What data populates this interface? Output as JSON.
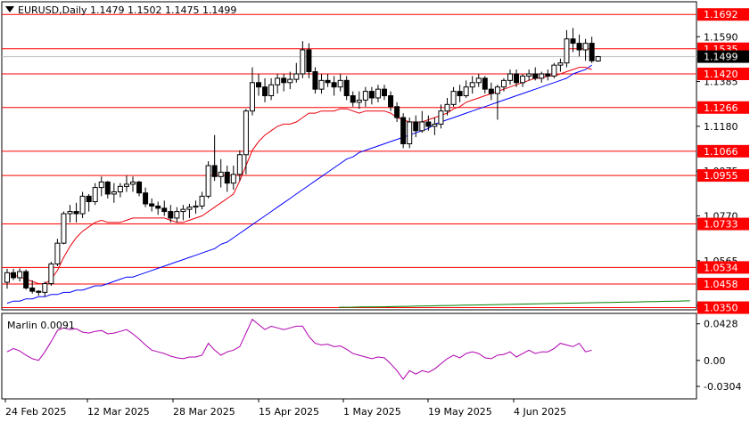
{
  "header": {
    "symbol": "EURUSD,Daily",
    "ohlc": "1.1479 1.1502 1.1475 1.1499"
  },
  "indicator": {
    "name": "Marlin",
    "value": "0.0091",
    "axis_ticks": [
      "0.0428",
      "0.00",
      "-0.0304"
    ]
  },
  "colors": {
    "level_line": "#ff0000",
    "candle_bull_body": "#ffffff",
    "candle_bear_body": "#000000",
    "ma_fast": "#e8000b",
    "ma_slow": "#0000ff",
    "ma_long": "#008000",
    "oscillator": "#b000b0",
    "price_label_bg": "#ff0000",
    "current_price_label_bg": "#000000"
  },
  "chart_data": {
    "type": "candlestick",
    "title": "EURUSD,Daily",
    "y_axis_ticks": [
      "1.1590",
      "1.1385",
      "1.1180",
      "1.0975",
      "1.0770",
      "1.0565",
      "1.0360"
    ],
    "x_axis_ticks": [
      "24 Feb 2025",
      "12 Mar 2025",
      "28 Mar 2025",
      "15 Apr 2025",
      "1 May 2025",
      "19 May 2025",
      "4 Jun 2025"
    ],
    "horizontal_levels": [
      "1.1692",
      "1.1535",
      "1.1420",
      "1.1266",
      "1.1066",
      "1.0955",
      "1.0733",
      "1.0534",
      "1.0458",
      "1.0350"
    ],
    "current_price": "1.1499",
    "ylim": [
      1.034,
      1.175
    ],
    "candles_ohlc": [
      [
        1.0466,
        1.0528,
        1.0437,
        1.051
      ],
      [
        1.051,
        1.0528,
        1.0476,
        1.0487
      ],
      [
        1.0487,
        1.053,
        1.047,
        1.0515
      ],
      [
        1.0515,
        1.0525,
        1.0432,
        1.044
      ],
      [
        1.044,
        1.0475,
        1.0415,
        1.0425
      ],
      [
        1.0425,
        1.043,
        1.0405,
        1.042
      ],
      [
        1.042,
        1.047,
        1.04,
        1.046
      ],
      [
        1.046,
        1.056,
        1.045,
        1.055
      ],
      [
        1.055,
        1.0665,
        1.054,
        1.0645
      ],
      [
        1.0645,
        1.079,
        1.064,
        1.078
      ],
      [
        1.078,
        1.082,
        1.074,
        1.079
      ],
      [
        1.079,
        1.083,
        1.074,
        1.078
      ],
      [
        1.078,
        1.088,
        1.076,
        1.086
      ],
      [
        1.086,
        1.087,
        1.079,
        1.0835
      ],
      [
        1.0835,
        1.092,
        1.082,
        1.09
      ],
      [
        1.09,
        1.095,
        1.086,
        1.0925
      ],
      [
        1.0925,
        1.093,
        1.085,
        1.087
      ],
      [
        1.087,
        1.092,
        1.083,
        1.088
      ],
      [
        1.088,
        1.092,
        1.0855,
        1.0905
      ],
      [
        1.0905,
        1.0955,
        1.088,
        1.0915
      ],
      [
        1.0915,
        1.095,
        1.088,
        1.0925
      ],
      [
        1.0925,
        1.093,
        1.086,
        1.0875
      ],
      [
        1.0875,
        1.09,
        1.081,
        1.0825
      ],
      [
        1.0825,
        1.085,
        1.079,
        1.0815
      ],
      [
        1.0815,
        1.0835,
        1.0775,
        1.0805
      ],
      [
        1.0805,
        1.084,
        1.077,
        1.079
      ],
      [
        1.079,
        1.082,
        1.074,
        1.076
      ],
      [
        1.076,
        1.081,
        1.074,
        1.079
      ],
      [
        1.079,
        1.082,
        1.075,
        1.08
      ],
      [
        1.08,
        1.0825,
        1.076,
        1.081
      ],
      [
        1.081,
        1.084,
        1.078,
        1.0815
      ],
      [
        1.0815,
        1.088,
        1.08,
        1.086
      ],
      [
        1.086,
        1.102,
        1.085,
        1.1
      ],
      [
        1.1,
        1.114,
        1.093,
        1.095
      ],
      [
        1.095,
        1.103,
        1.09,
        1.097
      ],
      [
        1.097,
        1.1,
        1.088,
        1.092
      ],
      [
        1.092,
        1.1,
        1.089,
        1.096
      ],
      [
        1.096,
        1.107,
        1.093,
        1.105
      ],
      [
        1.105,
        1.126,
        1.096,
        1.125
      ],
      [
        1.125,
        1.145,
        1.123,
        1.138
      ],
      [
        1.138,
        1.142,
        1.132,
        1.136
      ],
      [
        1.136,
        1.14,
        1.129,
        1.132
      ],
      [
        1.132,
        1.14,
        1.13,
        1.137
      ],
      [
        1.137,
        1.142,
        1.133,
        1.14
      ],
      [
        1.14,
        1.142,
        1.134,
        1.138
      ],
      [
        1.138,
        1.143,
        1.135,
        1.1395
      ],
      [
        1.1395,
        1.147,
        1.138,
        1.142
      ],
      [
        1.142,
        1.157,
        1.14,
        1.153
      ],
      [
        1.153,
        1.156,
        1.14,
        1.143
      ],
      [
        1.143,
        1.145,
        1.133,
        1.135
      ],
      [
        1.135,
        1.142,
        1.133,
        1.139
      ],
      [
        1.139,
        1.142,
        1.136,
        1.138
      ],
      [
        1.138,
        1.141,
        1.132,
        1.136
      ],
      [
        1.136,
        1.142,
        1.134,
        1.139
      ],
      [
        1.139,
        1.141,
        1.13,
        1.132
      ],
      [
        1.132,
        1.134,
        1.127,
        1.129
      ],
      [
        1.129,
        1.134,
        1.126,
        1.13
      ],
      [
        1.13,
        1.136,
        1.127,
        1.134
      ],
      [
        1.134,
        1.136,
        1.128,
        1.131
      ],
      [
        1.131,
        1.137,
        1.129,
        1.135
      ],
      [
        1.135,
        1.137,
        1.13,
        1.132
      ],
      [
        1.132,
        1.134,
        1.125,
        1.127
      ],
      [
        1.127,
        1.129,
        1.12,
        1.122
      ],
      [
        1.122,
        1.124,
        1.108,
        1.11
      ],
      [
        1.11,
        1.122,
        1.108,
        1.12
      ],
      [
        1.12,
        1.123,
        1.113,
        1.116
      ],
      [
        1.116,
        1.125,
        1.115,
        1.12
      ],
      [
        1.12,
        1.123,
        1.116,
        1.118
      ],
      [
        1.118,
        1.122,
        1.114,
        1.119
      ],
      [
        1.119,
        1.128,
        1.117,
        1.125
      ],
      [
        1.125,
        1.131,
        1.123,
        1.128
      ],
      [
        1.128,
        1.136,
        1.127,
        1.134
      ],
      [
        1.134,
        1.137,
        1.129,
        1.132
      ],
      [
        1.132,
        1.139,
        1.131,
        1.136
      ],
      [
        1.136,
        1.141,
        1.133,
        1.138
      ],
      [
        1.138,
        1.142,
        1.136,
        1.14
      ],
      [
        1.14,
        1.141,
        1.133,
        1.135
      ],
      [
        1.135,
        1.138,
        1.13,
        1.133
      ],
      [
        1.133,
        1.137,
        1.121,
        1.136
      ],
      [
        1.136,
        1.14,
        1.134,
        1.139
      ],
      [
        1.139,
        1.144,
        1.137,
        1.142
      ],
      [
        1.142,
        1.144,
        1.136,
        1.138
      ],
      [
        1.138,
        1.142,
        1.136,
        1.141
      ],
      [
        1.141,
        1.144,
        1.139,
        1.142
      ],
      [
        1.142,
        1.145,
        1.139,
        1.14
      ],
      [
        1.14,
        1.143,
        1.138,
        1.142
      ],
      [
        1.142,
        1.144,
        1.139,
        1.141
      ],
      [
        1.141,
        1.147,
        1.14,
        1.146
      ],
      [
        1.146,
        1.149,
        1.143,
        1.147
      ],
      [
        1.147,
        1.162,
        1.145,
        1.158
      ],
      [
        1.158,
        1.163,
        1.152,
        1.156
      ],
      [
        1.156,
        1.16,
        1.15,
        1.153
      ],
      [
        1.153,
        1.158,
        1.148,
        1.156
      ],
      [
        1.156,
        1.159,
        1.147,
        1.148
      ],
      [
        1.1479,
        1.1502,
        1.1475,
        1.1499
      ]
    ],
    "ma_fast": [
      1.051,
      1.05,
      1.049,
      1.048,
      1.047,
      1.046,
      1.046,
      1.048,
      1.052,
      1.058,
      1.063,
      1.067,
      1.07,
      1.072,
      1.074,
      1.075,
      1.074,
      1.074,
      1.074,
      1.075,
      1.076,
      1.076,
      1.076,
      1.076,
      1.076,
      1.076,
      1.075,
      1.074,
      1.074,
      1.075,
      1.076,
      1.077,
      1.079,
      1.081,
      1.083,
      1.085,
      1.087,
      1.093,
      1.1,
      1.107,
      1.111,
      1.114,
      1.116,
      1.118,
      1.119,
      1.119,
      1.12,
      1.122,
      1.124,
      1.124,
      1.125,
      1.125,
      1.125,
      1.126,
      1.126,
      1.125,
      1.124,
      1.125,
      1.125,
      1.125,
      1.125,
      1.124,
      1.122,
      1.121,
      1.12,
      1.12,
      1.12,
      1.121,
      1.122,
      1.123,
      1.124,
      1.126,
      1.127,
      1.129,
      1.13,
      1.131,
      1.132,
      1.133,
      1.134,
      1.135,
      1.136,
      1.137,
      1.138,
      1.139,
      1.14,
      1.14,
      1.141,
      1.141,
      1.142,
      1.143,
      1.144,
      1.145,
      1.145,
      1.144
    ],
    "ma_slow": [
      1.037,
      1.038,
      1.038,
      1.039,
      1.039,
      1.04,
      1.04,
      1.041,
      1.041,
      1.042,
      1.042,
      1.043,
      1.043,
      1.044,
      1.045,
      1.045,
      1.046,
      1.047,
      1.048,
      1.049,
      1.049,
      1.05,
      1.051,
      1.052,
      1.053,
      1.054,
      1.055,
      1.056,
      1.057,
      1.058,
      1.059,
      1.06,
      1.061,
      1.062,
      1.064,
      1.065,
      1.067,
      1.069,
      1.071,
      1.073,
      1.075,
      1.077,
      1.079,
      1.081,
      1.083,
      1.085,
      1.087,
      1.089,
      1.091,
      1.093,
      1.095,
      1.097,
      1.099,
      1.101,
      1.103,
      1.104,
      1.106,
      1.107,
      1.108,
      1.109,
      1.11,
      1.111,
      1.112,
      1.113,
      1.114,
      1.115,
      1.116,
      1.117,
      1.119,
      1.12,
      1.121,
      1.122,
      1.123,
      1.124,
      1.125,
      1.126,
      1.127,
      1.128,
      1.129,
      1.13,
      1.131,
      1.132,
      1.133,
      1.134,
      1.135,
      1.136,
      1.137,
      1.138,
      1.139,
      1.14,
      1.142,
      1.143,
      1.144,
      1.146
    ],
    "ma_long": [
      1.0352,
      1.0352,
      1.0353,
      1.0353,
      1.0354,
      1.0355,
      1.0356,
      1.0357,
      1.0358,
      1.0359,
      1.036,
      1.0361,
      1.0362,
      1.0363,
      1.0364,
      1.0365,
      1.0366,
      1.0367,
      1.0368,
      1.0369,
      1.037,
      1.0371,
      1.0372,
      1.0373,
      1.0374,
      1.0375,
      1.0376,
      1.0377,
      1.0378,
      1.0379,
      1.038,
      1.0381
    ],
    "oscillator": [
      0.01,
      0.014,
      0.011,
      0.006,
      0.002,
      0.0,
      0.01,
      0.022,
      0.035,
      0.038,
      0.036,
      0.037,
      0.033,
      0.032,
      0.034,
      0.035,
      0.031,
      0.032,
      0.034,
      0.036,
      0.031,
      0.025,
      0.018,
      0.012,
      0.01,
      0.008,
      0.005,
      0.003,
      0.002,
      0.004,
      0.004,
      0.006,
      0.02,
      0.012,
      0.006,
      0.01,
      0.012,
      0.016,
      0.032,
      0.048,
      0.042,
      0.036,
      0.04,
      0.038,
      0.036,
      0.038,
      0.04,
      0.04,
      0.028,
      0.02,
      0.018,
      0.019,
      0.016,
      0.017,
      0.013,
      0.008,
      0.006,
      0.004,
      0.002,
      0.004,
      0.003,
      -0.004,
      -0.012,
      -0.022,
      -0.012,
      -0.016,
      -0.012,
      -0.014,
      -0.01,
      -0.004,
      0.002,
      0.006,
      0.003,
      0.008,
      0.01,
      0.008,
      0.003,
      0.002,
      0.006,
      0.007,
      0.01,
      0.004,
      0.008,
      0.012,
      0.008,
      0.01,
      0.01,
      0.014,
      0.02,
      0.018,
      0.016,
      0.02,
      0.01,
      0.012
    ]
  }
}
